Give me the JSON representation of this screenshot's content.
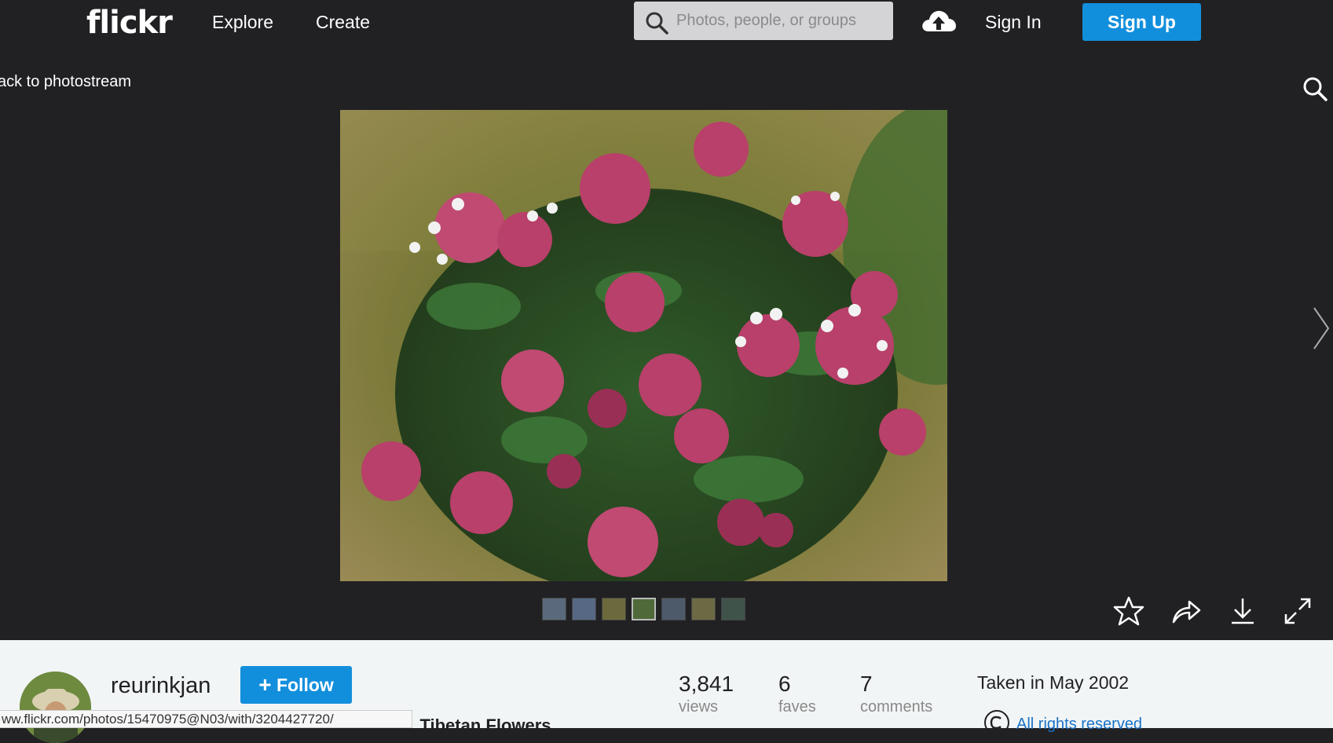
{
  "header": {
    "logo": "flickr",
    "nav": [
      "Explore",
      "Create"
    ],
    "search_placeholder": "Photos, people, or groups",
    "signin": "Sign In",
    "signup": "Sign Up"
  },
  "photo_page": {
    "back_link": "ack to photostream",
    "thumbnail_count": 7,
    "active_thumbnail_index": 3
  },
  "info": {
    "username": "reurinkjan",
    "follow_label": "Follow",
    "stats": [
      {
        "value": "3,841",
        "label": "views"
      },
      {
        "value": "6",
        "label": "faves"
      },
      {
        "value": "7",
        "label": "comments"
      }
    ],
    "taken": "Taken in May 2002",
    "rights": "All rights reserved",
    "album_title": "a, Tibetan Flowers"
  },
  "statusbar": {
    "url": "ww.flickr.com/photos/15470975@N03/with/3204427720/"
  },
  "colors": {
    "bg_dark": "#212124",
    "accent_blue": "#128fdc",
    "panel_light": "#f2f5f6"
  }
}
